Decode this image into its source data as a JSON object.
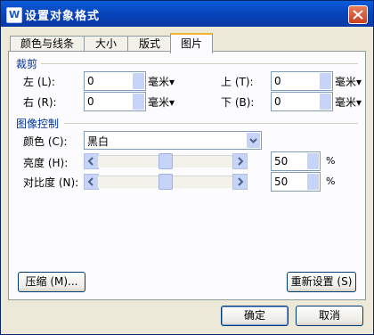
{
  "window": {
    "title": "设置对象格式",
    "app_icon_letter": "W"
  },
  "tabs": [
    {
      "label": "颜色与线条"
    },
    {
      "label": "大小"
    },
    {
      "label": "版式"
    },
    {
      "label": "图片"
    }
  ],
  "crop": {
    "title": "裁剪",
    "left": {
      "label": "左 (L):",
      "value": "0",
      "unit": "毫米▾"
    },
    "top": {
      "label": "上 (T):",
      "value": "0",
      "unit": "毫米▾"
    },
    "right": {
      "label": "右 (R):",
      "value": "0",
      "unit": "毫米▾"
    },
    "bottom": {
      "label": "下 (B):",
      "value": "0",
      "unit": "毫米▾"
    }
  },
  "image_control": {
    "title": "图像控制",
    "color": {
      "label": "颜色 (C):",
      "value": "黑白"
    },
    "brightness": {
      "label": "亮度 (H):",
      "value": "50",
      "unit": "%",
      "level": 50
    },
    "contrast": {
      "label": "对比度 (N):",
      "value": "50",
      "unit": "%",
      "level": 50
    }
  },
  "buttons": {
    "compress": "压缩 (M)...",
    "reset": "重新设置 (S)",
    "ok": "确定",
    "cancel": "取消"
  }
}
